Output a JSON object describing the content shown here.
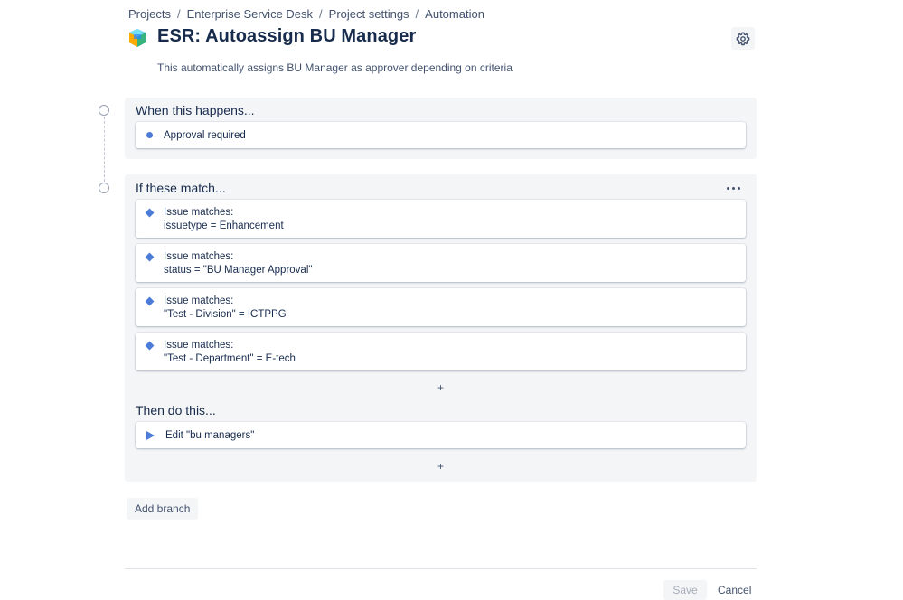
{
  "breadcrumb": {
    "items": [
      "Projects",
      "Enterprise Service Desk",
      "Project settings",
      "Automation"
    ],
    "separator": "/"
  },
  "header": {
    "title": "ESR: Autoassign BU Manager",
    "description": "This automatically assigns BU Manager as approver depending on criteria",
    "settings_icon": "gear-icon"
  },
  "trigger": {
    "heading": "When this happens...",
    "card_label": "Approval required"
  },
  "conditions": {
    "heading": "If these match...",
    "items": [
      {
        "line1": "Issue matches:",
        "line2": "issuetype = Enhancement"
      },
      {
        "line1": "Issue matches:",
        "line2": "status = \"BU Manager Approval\""
      },
      {
        "line1": "Issue matches:",
        "line2": "\"Test - Division\" = ICTPPG"
      },
      {
        "line1": "Issue matches:",
        "line2": "\"Test - Department\" = E-tech"
      }
    ],
    "add_symbol": "+"
  },
  "actions": {
    "heading": "Then do this...",
    "items": [
      {
        "label": "Edit \"bu managers\""
      }
    ],
    "add_symbol": "+"
  },
  "buttons": {
    "add_branch": "Add branch",
    "save": "Save",
    "cancel": "Cancel"
  },
  "colors": {
    "accent_blue": "#4C7BD8",
    "panel_bg": "#F4F5F7",
    "text": "#172B4D"
  }
}
